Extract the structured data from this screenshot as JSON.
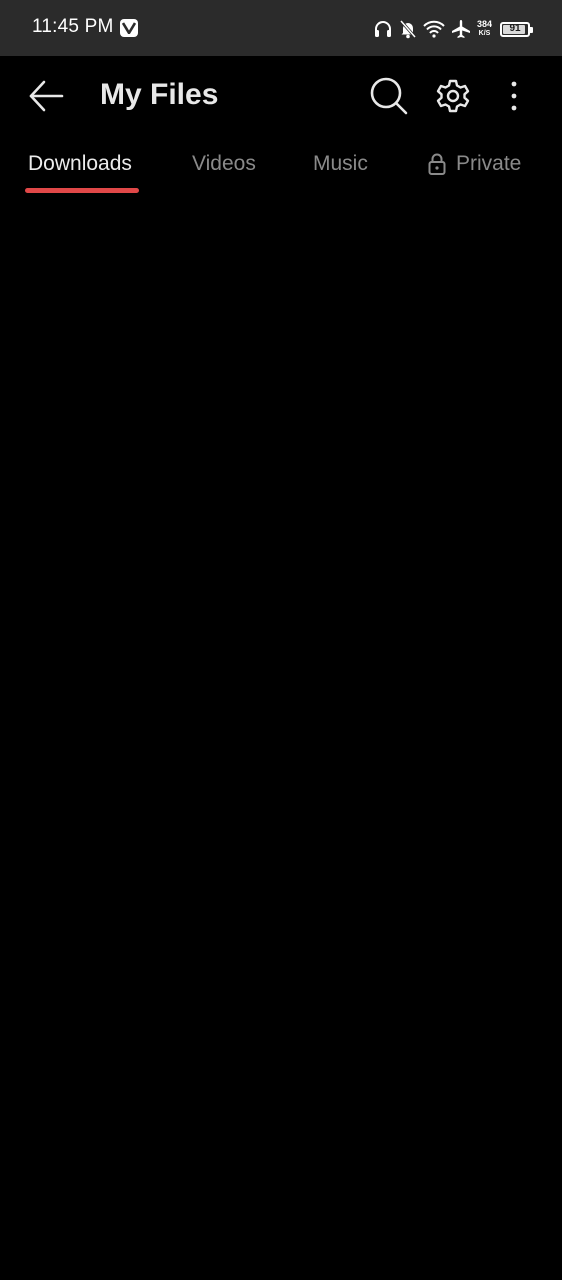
{
  "status_bar": {
    "time": "11:45 PM",
    "net_speed_value": "384",
    "net_speed_unit": "K/S",
    "battery_level": "91",
    "battery_fraction": 0.91,
    "icons": [
      "app-notification-icon",
      "headphones-icon",
      "notifications-muted-icon",
      "wifi-icon",
      "airplane-mode-icon",
      "battery-icon"
    ]
  },
  "app_bar": {
    "title": "My Files",
    "actions": [
      "back-arrow-icon",
      "search-icon",
      "gear-icon",
      "more-vert-icon"
    ]
  },
  "tabs": [
    {
      "label": "Downloads",
      "active": true
    },
    {
      "label": "Videos",
      "active": false
    },
    {
      "label": "Music",
      "active": false
    },
    {
      "label": "Private",
      "active": false,
      "icon": "lock-icon"
    }
  ],
  "colors": {
    "background": "#000000",
    "status_bar_bg": "#2b2b2b",
    "accent": "#e04848",
    "tab_active": "#ececec",
    "tab_inactive": "#8a8a8a",
    "title": "#e8e8e8"
  }
}
